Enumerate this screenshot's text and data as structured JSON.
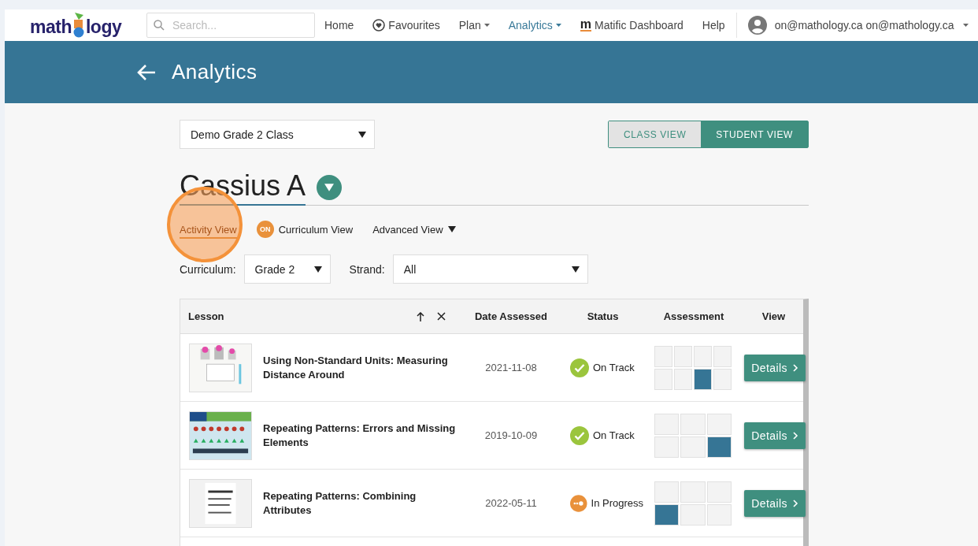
{
  "logo": {
    "before": "math",
    "after": "logy"
  },
  "search": {
    "placeholder": "Search..."
  },
  "nav": [
    {
      "label": "Home",
      "kind": "plain",
      "selected": false
    },
    {
      "label": "Favourites",
      "kind": "favourite",
      "selected": false
    },
    {
      "label": "Plan",
      "kind": "menu",
      "selected": false
    },
    {
      "label": "Analytics",
      "kind": "menu",
      "selected": true
    },
    {
      "label": "Matific Dashboard",
      "kind": "matific",
      "mark": "m",
      "selected": false
    },
    {
      "label": "Help",
      "kind": "plain",
      "selected": false
    }
  ],
  "user": {
    "email": "on@mathology.ca on@mathology.ca"
  },
  "banner": {
    "title": "Analytics"
  },
  "class_select": {
    "value": "Demo Grade 2 Class"
  },
  "view_toggle": [
    {
      "label": "CLASS VIEW",
      "selected": false
    },
    {
      "label": "STUDENT VIEW",
      "selected": true
    }
  ],
  "student": {
    "name": "Cassius A"
  },
  "view_tabs": [
    {
      "label": "Activity View",
      "kind": "plain",
      "selected": true,
      "highlighted": true
    },
    {
      "label": "Curriculum View",
      "kind": "badge",
      "badge": "ON",
      "selected": false,
      "highlighted": false
    },
    {
      "label": "Advanced View",
      "kind": "menu",
      "selected": false,
      "highlighted": false
    }
  ],
  "filters": [
    {
      "label": "Curriculum:",
      "value": "Grade 2"
    },
    {
      "label": "Strand:",
      "value": "All"
    }
  ],
  "table": {
    "columns": [
      "Lesson",
      "Date Assessed",
      "Status",
      "Assessment",
      "View"
    ],
    "rows": [
      {
        "lesson": "Using Non-Standard Units: Measuring Distance Around",
        "date": "2021-11-08",
        "status": "On Track",
        "kind": "on_track",
        "button": "Details",
        "assessment": [
          {
            "filled": false
          },
          {
            "filled": false
          },
          {
            "filled": false
          },
          {
            "filled": false
          },
          {
            "filled": false
          },
          {
            "filled": false
          },
          {
            "filled": true
          },
          {
            "filled": false
          }
        ]
      },
      {
        "lesson": "Repeating Patterns: Errors and Missing Elements",
        "date": "2019-10-09",
        "status": "On Track",
        "kind": "on_track",
        "button": "Details",
        "assessment": [
          {
            "filled": false
          },
          {
            "filled": false
          },
          {
            "filled": false
          },
          {
            "filled": false
          },
          {
            "filled": false
          },
          {
            "filled": true
          }
        ]
      },
      {
        "lesson": "Repeating Patterns: Combining Attributes",
        "date": "2022-05-11",
        "status": "In Progress",
        "kind": "in_progress",
        "button": "Details",
        "assessment": [
          {
            "filled": false
          },
          {
            "filled": false
          },
          {
            "filled": false
          },
          {
            "filled": true
          },
          {
            "filled": false
          },
          {
            "filled": false
          }
        ]
      }
    ]
  }
}
